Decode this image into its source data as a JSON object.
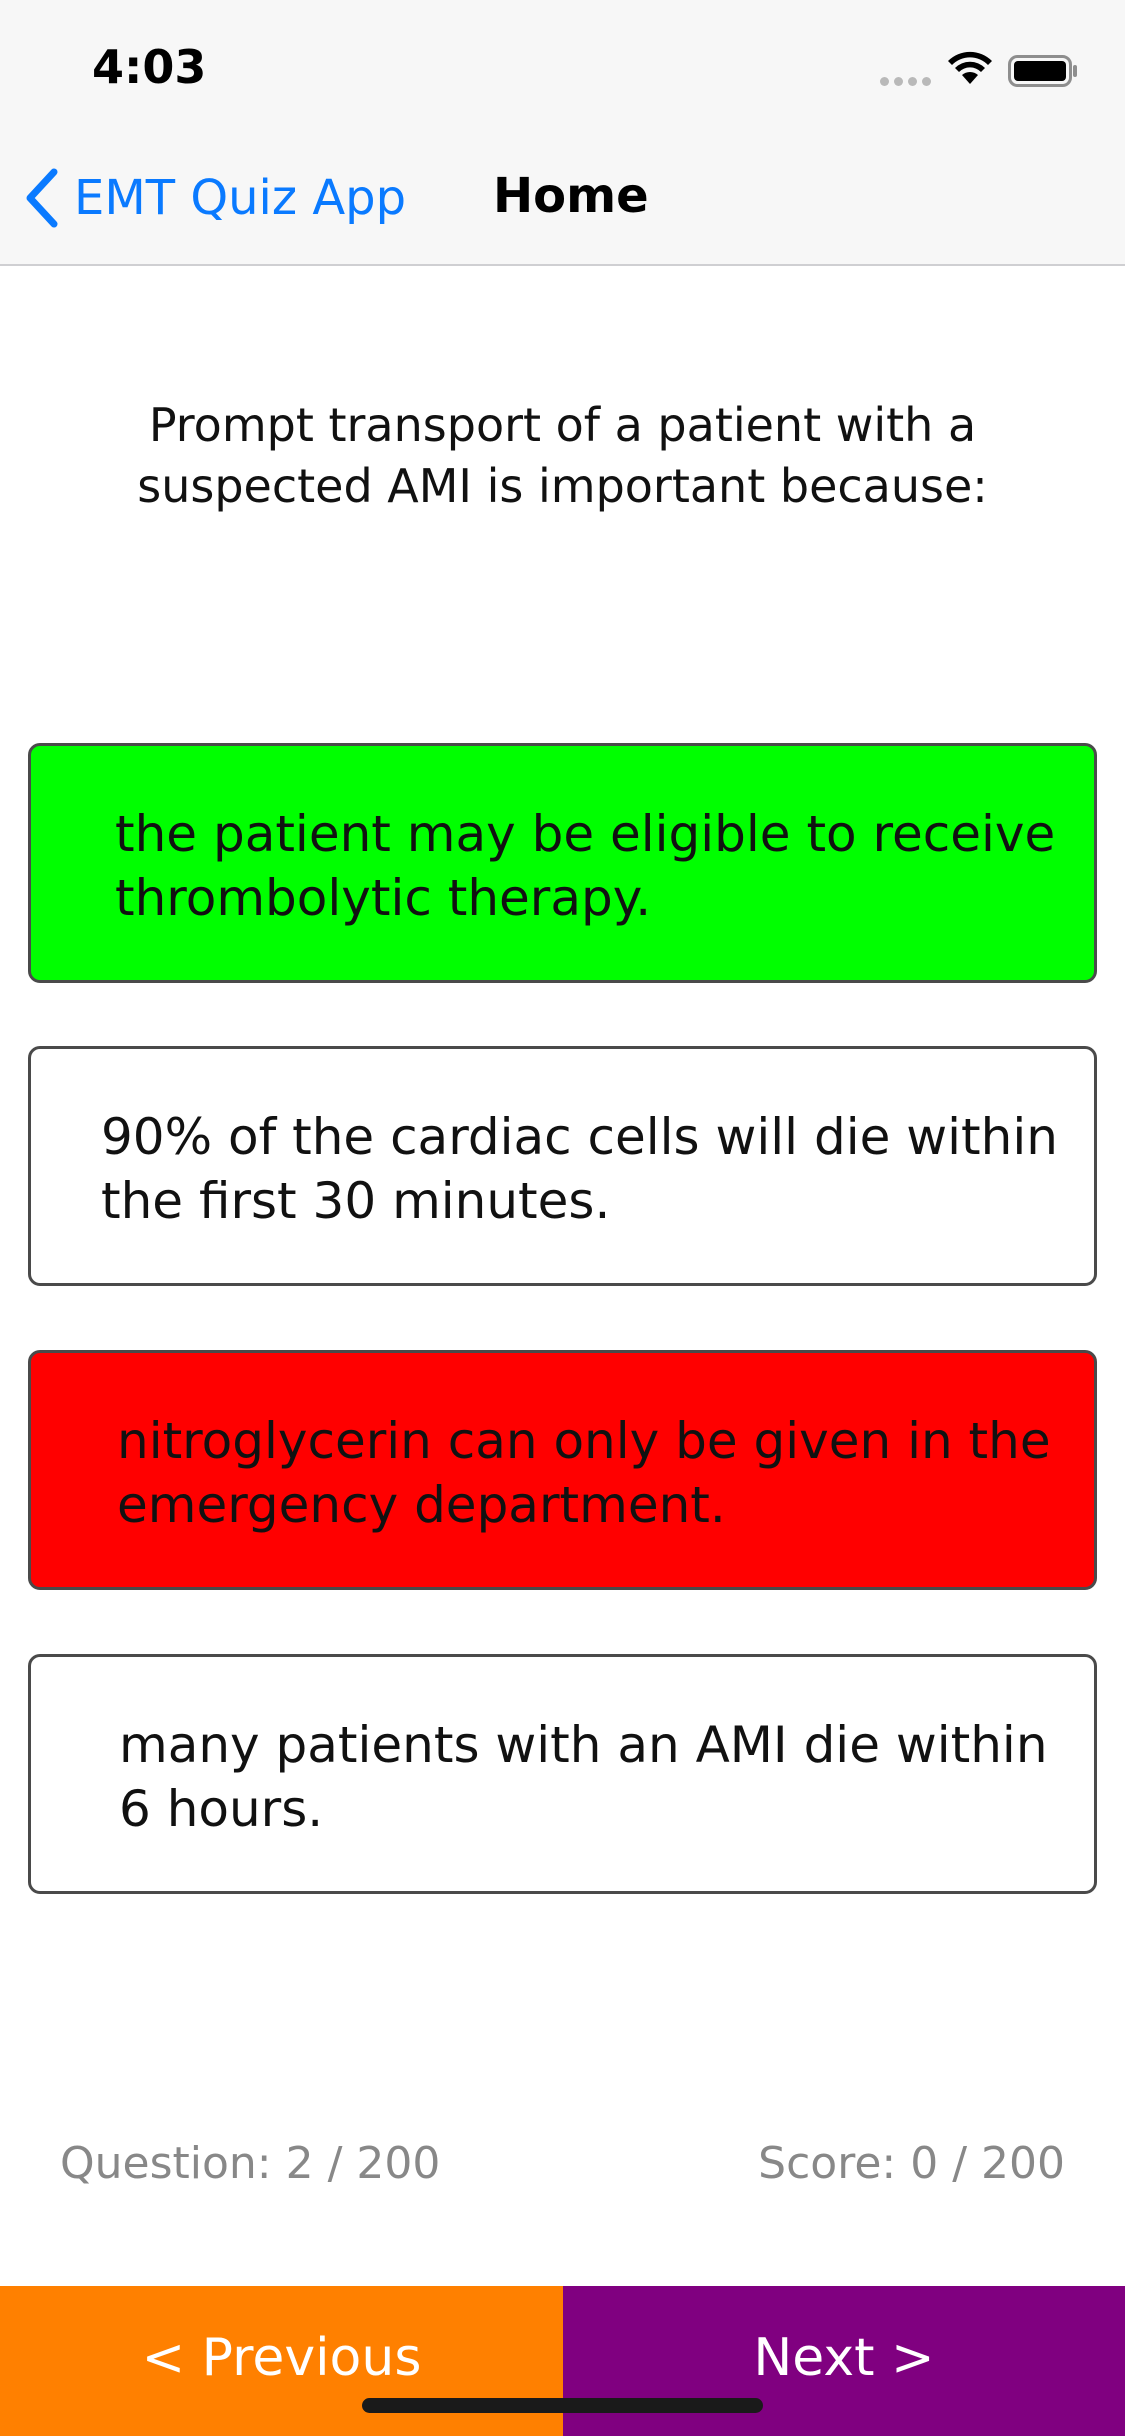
{
  "status_bar": {
    "time": "4:03"
  },
  "nav": {
    "back_label": "EMT Quiz App",
    "title": "Home"
  },
  "question": {
    "text": "Prompt transport of a patient with a suspected AMI is important because:"
  },
  "answers": [
    {
      "text": "the patient may be eligible to receive thrombolytic therapy.",
      "state": "correct",
      "color": "#00ff00"
    },
    {
      "text": "90% of the cardiac cells will die within the first 30 minutes.",
      "state": "neutral",
      "color": "#ffffff"
    },
    {
      "text": "nitroglycerin can only be given in the emergency department.",
      "state": "incorrect",
      "color": "#ff0000"
    },
    {
      "text": "many patients with an AMI die within 6 hours.",
      "state": "neutral",
      "color": "#ffffff"
    }
  ],
  "progress": {
    "question_label": "Question: 2 / 200",
    "score_label": "Score: 0 / 200"
  },
  "buttons": {
    "previous_label": "< Previous",
    "previous_color": "#ff8000",
    "next_label": "Next >",
    "next_color": "#800080"
  },
  "icons": {
    "back": "chevron-left-icon",
    "wifi": "wifi-icon",
    "battery": "battery-icon",
    "signal": "cellular-signal-icon"
  }
}
